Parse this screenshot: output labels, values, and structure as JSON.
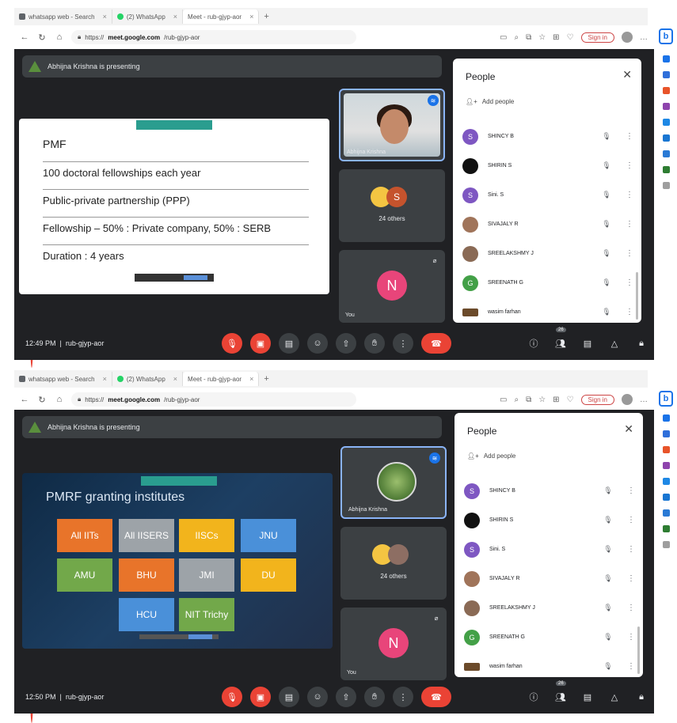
{
  "browser": {
    "tabs": [
      {
        "label": "whatsapp web - Search",
        "icon": "search"
      },
      {
        "label": "(2) WhatsApp",
        "icon": "whatsapp"
      },
      {
        "label": "Meet - rub-gjyp-aor",
        "icon": "meet"
      }
    ],
    "url_prefix": "https://",
    "url_domain": "meet.google.com",
    "url_path": "/rub-gjyp-aor",
    "signin_label": "Sign in"
  },
  "shots": [
    {
      "presenter_text": "Abhijna Krishna is presenting",
      "slide": {
        "title": "PMF",
        "rows": [
          "100 doctoral fellowships each year",
          "Public-private partnership (PPP)",
          "Fellowship – 50% : Private company, 50% : SERB",
          "Duration : 4 years"
        ]
      },
      "tiles": {
        "speaker_name": "Abhijna Krishna",
        "others_label": "24 others",
        "others_badge": "S",
        "self_initial": "N",
        "self_label": "You"
      },
      "people": {
        "title": "People",
        "add_label": "Add people",
        "participants": [
          {
            "name": "SHINCY B",
            "initial": "S",
            "color": "#7e57c2"
          },
          {
            "name": "SHIRIN S",
            "initial": "",
            "color": "#111111"
          },
          {
            "name": "Sini. S",
            "initial": "S",
            "color": "#7e57c2"
          },
          {
            "name": "SIVAJALY R",
            "initial": "",
            "color": "#a0745a"
          },
          {
            "name": "SREELAKSHMY J",
            "initial": "",
            "color": "#8a6a55"
          },
          {
            "name": "SREENATH G",
            "initial": "G",
            "color": "#43a047"
          },
          {
            "name": "wasim farhan",
            "initial": "",
            "color": "#6b4a2a"
          }
        ]
      },
      "bottom": {
        "time": "12:49 PM",
        "meeting_code": "rub-gjyp-aor",
        "people_count": "26"
      }
    },
    {
      "presenter_text": "Abhijna Krishna is presenting",
      "slide": {
        "title": "PMRF granting institutes",
        "institutes": [
          {
            "label": "All IITs",
            "color": "orange"
          },
          {
            "label": "All IISERS",
            "color": "grey"
          },
          {
            "label": "IISCs",
            "color": "yellow"
          },
          {
            "label": "JNU",
            "color": "blue"
          },
          {
            "label": "AMU",
            "color": "green"
          },
          {
            "label": "BHU",
            "color": "orange"
          },
          {
            "label": "JMI",
            "color": "grey"
          },
          {
            "label": "DU",
            "color": "yellow"
          },
          {
            "label": "HCU",
            "color": "blue"
          },
          {
            "label": "NIT Trichy",
            "color": "green"
          }
        ]
      },
      "tiles": {
        "speaker_name": "Abhijna Krishna",
        "others_label": "24 others",
        "self_initial": "N",
        "self_label": "You"
      },
      "people": {
        "title": "People",
        "add_label": "Add people",
        "participants": [
          {
            "name": "SHINCY B",
            "initial": "S",
            "color": "#7e57c2"
          },
          {
            "name": "SHIRIN S",
            "initial": "",
            "color": "#111111"
          },
          {
            "name": "Sini. S",
            "initial": "S",
            "color": "#7e57c2"
          },
          {
            "name": "SIVAJALY R",
            "initial": "",
            "color": "#a0745a"
          },
          {
            "name": "SREELAKSHMY J",
            "initial": "",
            "color": "#8a6a55"
          },
          {
            "name": "SREENATH G",
            "initial": "G",
            "color": "#43a047"
          },
          {
            "name": "wasim farhan",
            "initial": "",
            "color": "#6b4a2a"
          }
        ]
      },
      "bottom": {
        "time": "12:50 PM",
        "meeting_code": "rub-gjyp-aor",
        "people_count": "26"
      }
    }
  ],
  "colors": {
    "meet_bg": "#202124",
    "tile_bg": "#3c4043",
    "end_call": "#ea4335",
    "accent": "#1a73e8"
  }
}
